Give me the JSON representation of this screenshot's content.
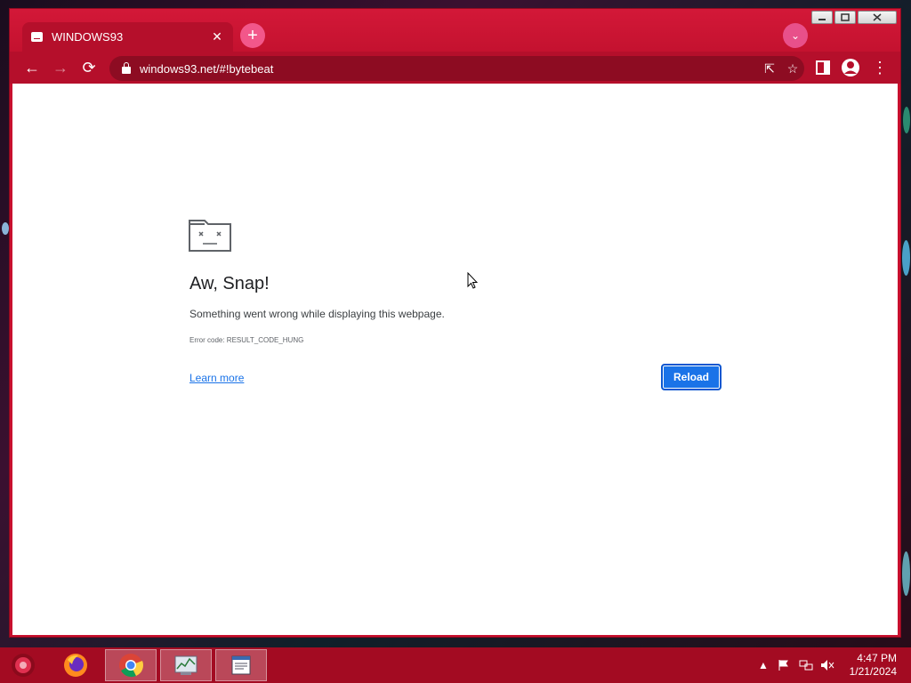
{
  "window": {
    "caption_buttons": {
      "minimize": "minimize-icon",
      "maximize": "maximize-icon",
      "close": "close-icon"
    }
  },
  "tab": {
    "title": "WINDOWS93",
    "close_glyph": "✕"
  },
  "new_tab_glyph": "+",
  "tab_search_glyph": "⌄",
  "toolbar": {
    "back": "←",
    "forward": "→",
    "reload": "⟳",
    "url": "windows93.net/#!bytebeat",
    "share": "⇱",
    "bookmark": "☆",
    "menu": "⋮"
  },
  "error_page": {
    "title": "Aw, Snap!",
    "description": "Something went wrong while displaying this webpage.",
    "error_code": "Error code: RESULT_CODE_HUNG",
    "learn_more": "Learn more",
    "reload_button": "Reload"
  },
  "taskbar": {
    "apps": [
      "start-orb-icon",
      "firefox-icon",
      "chrome-icon",
      "task-manager-icon",
      "notepad-icon"
    ],
    "clock_time": "4:47 PM",
    "clock_date": "1/21/2024",
    "tray_up": "▲"
  },
  "colors": {
    "accent": "#c8102e",
    "toolbar": "#b50f2b",
    "link": "#1a73e8",
    "taskbar": "#a30b22"
  }
}
